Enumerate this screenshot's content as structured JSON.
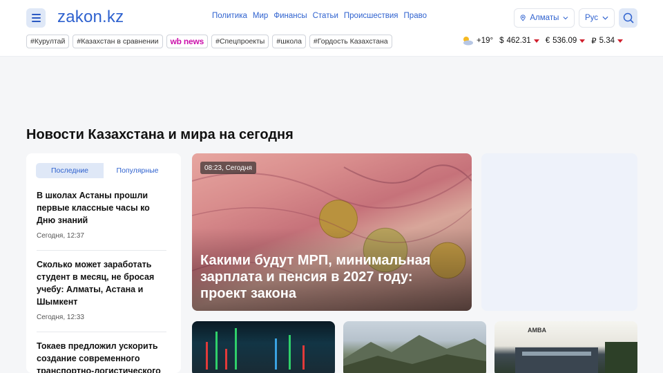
{
  "header": {
    "logo": "zakon.kz",
    "nav": [
      "Политика",
      "Мир",
      "Финансы",
      "Статьи",
      "Происшествия",
      "Право"
    ],
    "city": "Алматы",
    "language": "Рус"
  },
  "tags": [
    "#Курултай",
    "#Казахстан в сравнении",
    "wb news",
    "#Спецпроекты",
    "#школа",
    "#Гордость Казахстана"
  ],
  "weather": {
    "temp": "+19°"
  },
  "rates": [
    {
      "symbol": "$",
      "value": "462.31"
    },
    {
      "symbol": "€",
      "value": "536.09"
    },
    {
      "symbol": "₽",
      "value": "5.34"
    }
  ],
  "colors": {
    "accent": "#2f62cf",
    "down": "#d0202e",
    "wb": "#cb11ab"
  },
  "page_title": "Новости Казахстана и мира на сегодня",
  "sidebar": {
    "tabs": [
      "Последние",
      "Популярные"
    ],
    "news": [
      {
        "title": "В школах Астаны прошли первые классные часы ко Дню знаний",
        "time": "Сегодня, 12:37"
      },
      {
        "title": "Сколько может заработать студент в месяц, не бросая учебу: Алматы, Астана и Шымкент",
        "time": "Сегодня, 12:33"
      },
      {
        "title": "Токаев предложил ускорить создание современного транспортно-логистического",
        "time": ""
      }
    ]
  },
  "hero": {
    "time": "08:23, Сегодня",
    "title": "Какими будут МРП, минимальная зарплата и пенсия в 2027 году: проект закона"
  },
  "cards": {
    "card3_label": "AMBA"
  }
}
